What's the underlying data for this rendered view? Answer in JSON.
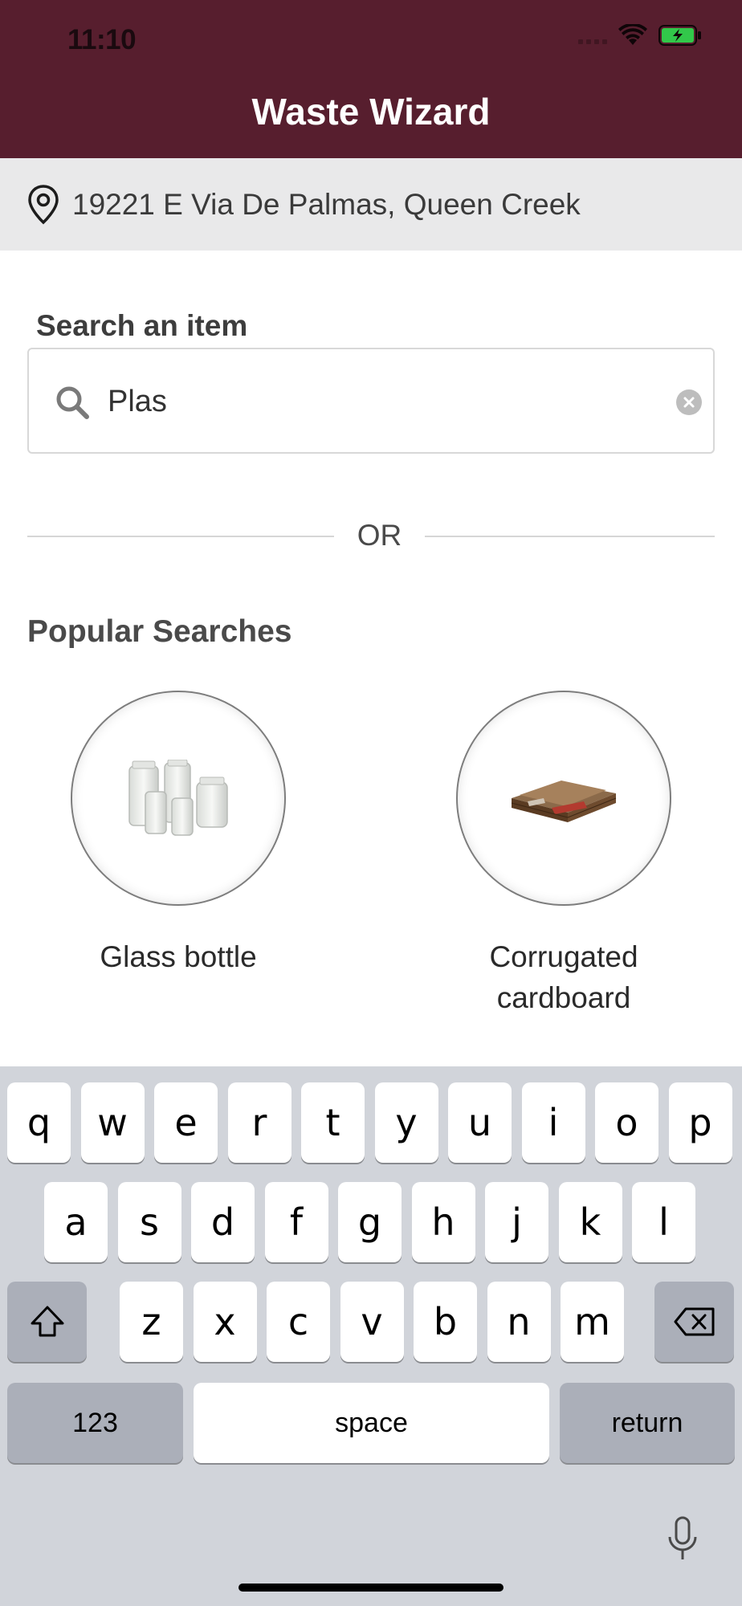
{
  "status_bar": {
    "time": "11:10"
  },
  "header": {
    "title": "Waste Wizard"
  },
  "location": {
    "address": "19221 E Via De Palmas, Queen Creek"
  },
  "search": {
    "label": "Search an item",
    "value": "Plas"
  },
  "divider": {
    "text": "OR"
  },
  "popular": {
    "title": "Popular Searches",
    "items": [
      {
        "label": "Glass bottle",
        "image": "glass-jars-image"
      },
      {
        "label": "Corrugated cardboard",
        "image": "cardboard-image"
      }
    ]
  },
  "keyboard": {
    "row1": [
      "q",
      "w",
      "e",
      "r",
      "t",
      "y",
      "u",
      "i",
      "o",
      "p"
    ],
    "row2": [
      "a",
      "s",
      "d",
      "f",
      "g",
      "h",
      "j",
      "k",
      "l"
    ],
    "row3": [
      "z",
      "x",
      "c",
      "v",
      "b",
      "n",
      "m"
    ],
    "numbers_label": "123",
    "space_label": "space",
    "return_label": "return",
    "shift_icon": "shift-icon",
    "delete_icon": "backspace-icon",
    "mic_icon": "microphone-icon"
  },
  "colors": {
    "header_bg": "#571e2e",
    "location_bg": "#e9e9ea",
    "keyboard_bg": "#d1d4da"
  }
}
